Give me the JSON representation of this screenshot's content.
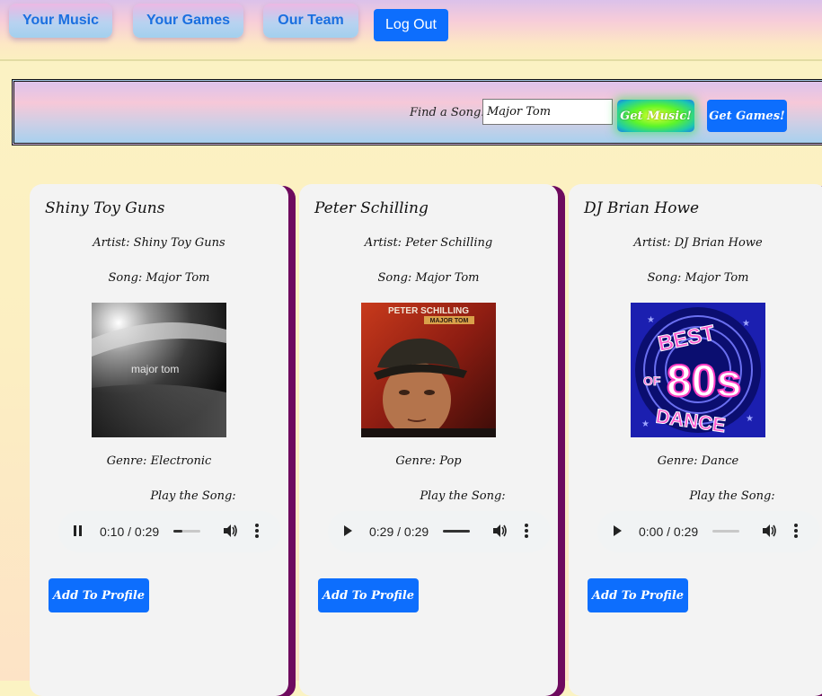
{
  "nav": {
    "your_music": "Your Music",
    "your_games": "Your Games",
    "our_team": "Our Team",
    "logout": "Log Out"
  },
  "search": {
    "label": "Find a Song:",
    "value": "Major Tom",
    "get_music": "Get Music!",
    "get_games": "Get Games!"
  },
  "cards": [
    {
      "title": "Shiny Toy Guns",
      "artist": "Artist: Shiny Toy Guns",
      "song": "Song: Major Tom",
      "cover_text": "major tom",
      "genre": "Genre: Electronic",
      "play_label": "Play the Song:",
      "player": {
        "state": "playing",
        "time": "0:10 / 0:29",
        "progress": 0.34
      },
      "add_label": "Add To Profile"
    },
    {
      "title": "Peter Schilling",
      "artist": "Artist: Peter Schilling",
      "song": "Song: Major Tom",
      "cover_title": "PETER SCHILLING",
      "cover_sub": "MAJOR TOM",
      "genre": "Genre: Pop",
      "play_label": "Play the Song:",
      "player": {
        "state": "paused",
        "time": "0:29 / 0:29",
        "progress": 1.0
      },
      "add_label": "Add To Profile"
    },
    {
      "title": "DJ Brian Howe",
      "artist": "Artist: DJ Brian Howe",
      "song": "Song: Major Tom",
      "cover_best": "BEST",
      "cover_of": "OF",
      "cover_80s": "80s",
      "cover_dance": "DANCE",
      "genre": "Genre: Dance",
      "play_label": "Play the Song:",
      "player": {
        "state": "paused",
        "time": "0:00 / 0:29",
        "progress": 0.0
      },
      "add_label": "Add To Profile"
    }
  ]
}
